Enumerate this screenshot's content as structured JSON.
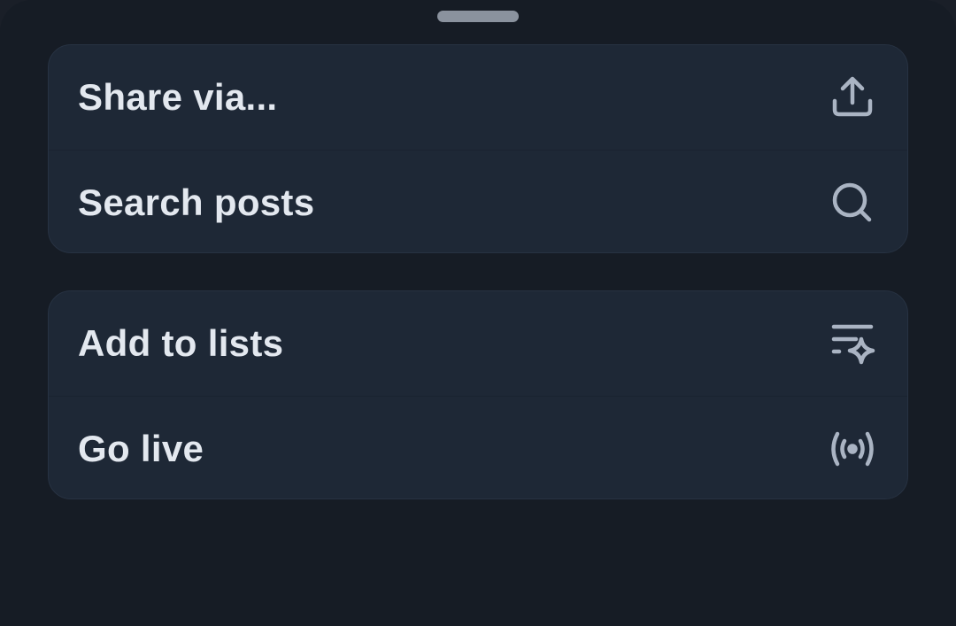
{
  "sheet": {
    "groups": [
      {
        "items": [
          {
            "label": "Share via...",
            "icon": "share-icon"
          },
          {
            "label": "Search posts",
            "icon": "search-icon"
          }
        ]
      },
      {
        "items": [
          {
            "label": "Add to lists",
            "icon": "list-sparkle-icon"
          },
          {
            "label": "Go live",
            "icon": "broadcast-icon"
          }
        ]
      }
    ]
  },
  "colors": {
    "background": "#161c25",
    "card": "#1e2836",
    "text": "#e3e8ef",
    "icon": "#aab4c3",
    "handle": "#8a929e"
  }
}
